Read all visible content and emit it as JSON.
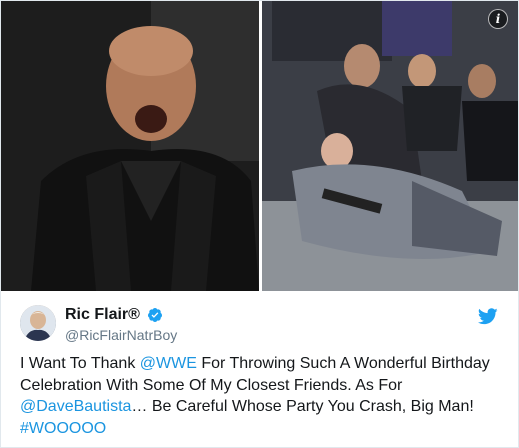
{
  "tweet": {
    "display_name": "Ric Flair®",
    "handle": "@RicFlairNatrBoy",
    "verified": true,
    "text_parts": {
      "p1": "I Want To Thank ",
      "mention1": "@WWE",
      "p2": " For Throwing Such A Wonderful Birthday Celebration With Some Of My Closest Friends. As For ",
      "mention2": "@DaveBautista",
      "p3": "… Be Careful Whose Party You Crash, Big Man! ",
      "hashtag": "#WOOOOO"
    }
  },
  "media": {
    "left_photo": "wrestler-shouting",
    "right_photo": "men-kneeling-over-man-on-floor",
    "info_icon": "info-icon"
  },
  "icons": {
    "bird": "twitter-bird-icon",
    "verified": "verified-badge-icon"
  },
  "colors": {
    "link": "#1b95e0",
    "text": "#14171a",
    "secondary": "#657786",
    "verified": "#1da1f2"
  }
}
